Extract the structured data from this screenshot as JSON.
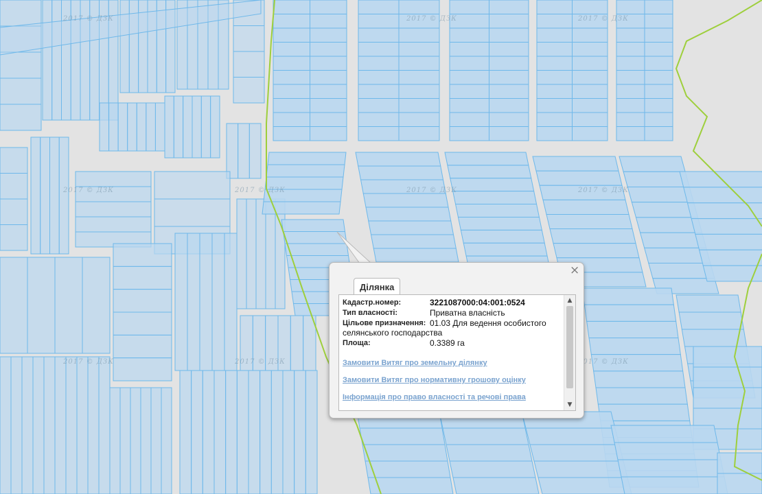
{
  "map": {
    "watermark": "2017 © ДЗК",
    "colors": {
      "background": "#e3e3e3",
      "parcel_fill": "#b9d7f0",
      "parcel_stroke": "#6eb8ea",
      "boundary": "#9ecf3c"
    }
  },
  "popup": {
    "tab_label": "Ділянка",
    "close_glyph": "×",
    "fields": [
      {
        "label": "Кадастр.номер:",
        "value": "3221087000:04:001:0524"
      },
      {
        "label": "Тип власності:",
        "value": "Приватна власність"
      },
      {
        "label": "Цільове призначення:",
        "value": "01.03 Для ведення особистого",
        "value_cont": "селянського господарства"
      },
      {
        "label": "Площа:",
        "value": "0.3389 га"
      }
    ],
    "links": [
      "Замовити Витяг про земельну ділянку",
      "Замовити Витяг про нормативну грошову оцінку",
      "Інформація про право власності та речові права"
    ],
    "scroll_up_icon": "▲",
    "scroll_down_icon": "▼"
  }
}
